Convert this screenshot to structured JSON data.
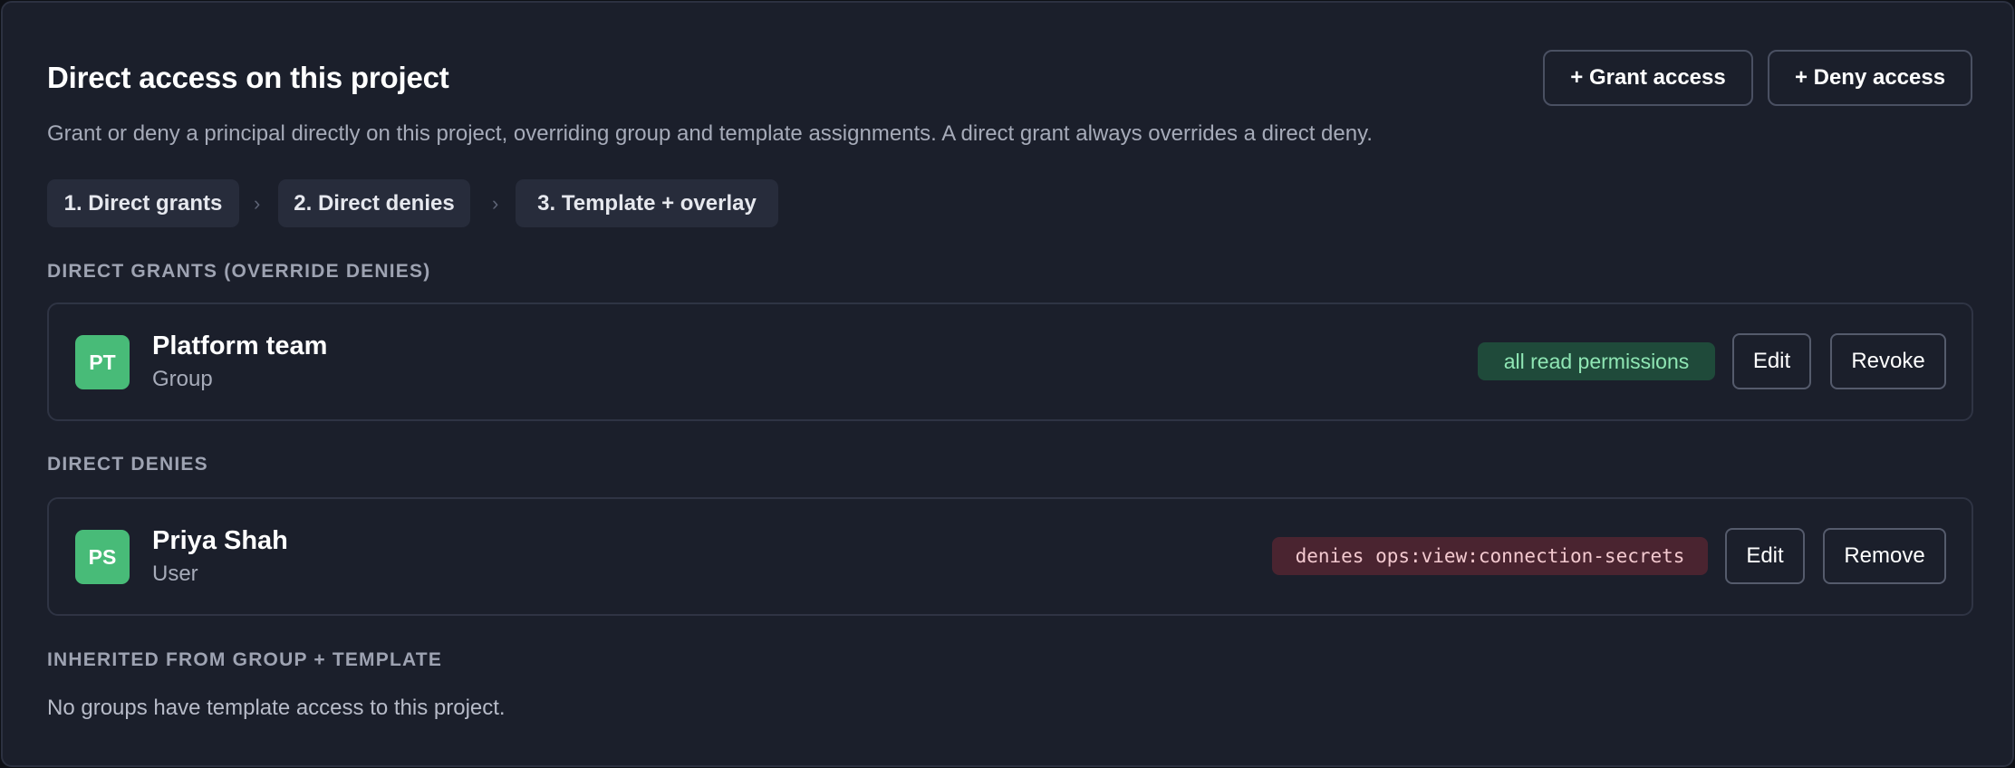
{
  "header": {
    "title": "Direct access on this project",
    "subtitle": "Grant or deny a principal directly on this project, overriding group and template assignments. A direct grant always overrides a direct deny.",
    "grant_label": "+ Grant access",
    "deny_label": "+ Deny access"
  },
  "steps": [
    {
      "label": "1. Direct grants"
    },
    {
      "label": "2. Direct denies"
    },
    {
      "label": "3. Template + overlay"
    }
  ],
  "step_separator": "›",
  "grants": {
    "heading": "DIRECT GRANTS (OVERRIDE DENIES)",
    "items": [
      {
        "initials": "PT",
        "name": "Platform team",
        "type": "Group",
        "badge": "all read permissions",
        "edit_label": "Edit",
        "action_label": "Revoke"
      }
    ]
  },
  "denies": {
    "heading": "DIRECT DENIES",
    "items": [
      {
        "initials": "PS",
        "name": "Priya Shah",
        "type": "User",
        "badge": "denies ops:view:connection-secrets",
        "edit_label": "Edit",
        "action_label": "Remove"
      }
    ]
  },
  "inherited": {
    "heading": "INHERITED FROM GROUP + TEMPLATE",
    "empty_text": "No groups have template access to this project."
  },
  "colors": {
    "background": "#1b1f2b",
    "avatar": "#48bb78",
    "grant_badge_bg": "#1f4a3a",
    "grant_badge_text": "#8fe6b4",
    "deny_badge_bg": "#4a2430",
    "deny_badge_text": "#f3c9cf"
  }
}
